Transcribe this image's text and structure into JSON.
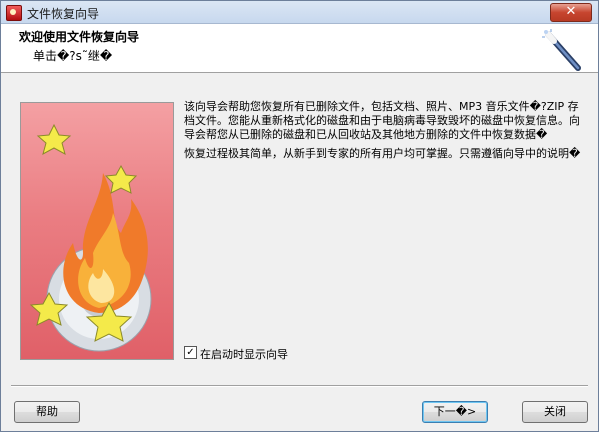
{
  "window": {
    "title": "文件恢复向导",
    "close_glyph": "✕"
  },
  "header": {
    "title": "欢迎使用文件恢复向导",
    "subtitle": "单击�?s˜继�"
  },
  "body": {
    "paragraph1": "该向导会帮助您恢复所有已删除文件，包括文档、照片、MP3 音乐文件�?ZIP 存档文件。您能从重新格式化的磁盘和由于电脑病毒导致毁坏的磁盘中恢复信息。向导会帮您从已删除的磁盘和已从回收站及其他地方删除的文件中恢复数据�",
    "paragraph2": "恢复过程极其简单，从新手到专家的所有用户均可掌握。只需遵循向导中的说明�"
  },
  "options": {
    "show_on_startup_label": "在启动时显示向导",
    "show_on_startup_checked": true,
    "check_glyph": "✓"
  },
  "buttons": {
    "help": "帮助",
    "next": "下一�>",
    "close": "关闭"
  },
  "icons": {
    "app": "app-recovery-icon",
    "header": "magic-wand-icon",
    "side": "fire-disc-stars-icon"
  }
}
